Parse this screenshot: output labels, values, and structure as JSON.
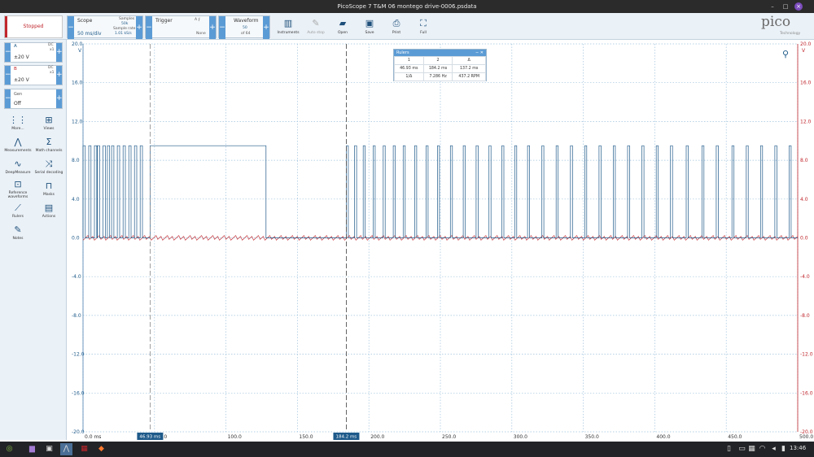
{
  "window": {
    "title": "PicoScope 7 T&M 06 montego drive-0006.psdata"
  },
  "toolbar": {
    "status": "Stopped",
    "scope": {
      "label": "Scope",
      "timebase": "50 ms/div",
      "samples_label": "Samples",
      "samples_value": "50k",
      "rate_label": "Sample rate",
      "rate_value": "1.01 kS/s"
    },
    "trigger": {
      "label": "Trigger",
      "mode": "None",
      "edge": "A ⨍"
    },
    "waveform": {
      "label": "Waveform",
      "current": "50",
      "of": "of 64"
    },
    "instruments_label": "Instruments",
    "autostop_label": "Auto stop",
    "open_label": "Open",
    "save_label": "Save",
    "print_label": "Print",
    "full_label": "Full",
    "brand": "pico",
    "brand_sub": "Technology"
  },
  "channels": [
    {
      "name": "A",
      "coupling": "DC",
      "probe": "x1",
      "range": "±20 V",
      "color": "#1e5a8a"
    },
    {
      "name": "B",
      "coupling": "DC",
      "probe": "x1",
      "range": "±20 V",
      "color": "#c0262d"
    }
  ],
  "generator": {
    "label": "Gen",
    "state": "Off"
  },
  "side_tools": [
    {
      "label": "More...",
      "icon": "dots-grid-icon"
    },
    {
      "label": "Views",
      "icon": "grid-icon"
    },
    {
      "label": "Measurements",
      "icon": "measure-icon"
    },
    {
      "label": "Math channels",
      "icon": "sigma-icon"
    },
    {
      "label": "DeepMeasure",
      "icon": "deepmeasure-icon"
    },
    {
      "label": "Serial decoding",
      "icon": "serial-icon"
    },
    {
      "label": "Reference waveforms",
      "icon": "reference-icon"
    },
    {
      "label": "Masks",
      "icon": "mask-icon"
    },
    {
      "label": "Rulers",
      "icon": "ruler-icon"
    },
    {
      "label": "Actions",
      "icon": "actions-icon"
    },
    {
      "label": "Notes",
      "icon": "notes-icon"
    }
  ],
  "rulers_panel": {
    "title": "Rulers",
    "headers": [
      "1",
      "2",
      "Δ"
    ],
    "row1": [
      "46.93 ms",
      "184.2 ms",
      "137.2 ms"
    ],
    "row2": [
      "1/Δ",
      "7.286 Hz",
      "437.2 RPM"
    ]
  },
  "cursors": {
    "left": "46.93 ms",
    "right": "184.2 ms"
  },
  "chart_data": {
    "type": "line",
    "x_unit": "ms",
    "xlim": [
      0,
      500
    ],
    "x_ticks": [
      "0.0 ms",
      "50.0",
      "100.0",
      "150.0",
      "200.0",
      "250.0",
      "300.0",
      "350.0",
      "400.0",
      "450.0",
      "500.0"
    ],
    "y_axes": [
      {
        "name": "A",
        "unit": "V",
        "lim": [
          -20,
          20
        ],
        "ticks": [
          "20.0",
          "16.0",
          "12.0",
          "8.0",
          "4.0",
          "0.0",
          "-4.0",
          "-8.0",
          "-12.0",
          "-16.0",
          "-20.0"
        ],
        "color": "#1e5a8a"
      },
      {
        "name": "B",
        "unit": "V",
        "lim": [
          -20,
          20
        ],
        "ticks": [
          "20.0",
          "16.0",
          "12.0",
          "8.0",
          "4.0",
          "0.0",
          "-4.0",
          "-8.0",
          "-12.0",
          "-16.0",
          "-20.0"
        ],
        "color": "#c0262d"
      }
    ],
    "grid": true,
    "series": [
      {
        "name": "A",
        "color": "#1e5a8a",
        "pulses_early_ms": [
          0,
          4,
          8,
          10,
          14,
          17,
          20,
          24,
          28,
          32,
          36,
          40
        ],
        "high_block_ms": [
          46.93,
          128
        ],
        "pulses_late_ms": [
          184.2,
          190,
          196,
          203,
          210,
          217,
          224,
          232,
          240,
          248,
          257,
          266,
          275,
          284,
          293,
          302,
          311,
          321,
          331,
          341,
          351,
          361,
          371,
          381,
          391,
          401,
          411,
          422,
          433,
          443,
          454,
          464,
          474,
          484,
          494
        ],
        "high_level_V": 9.5,
        "low_level_V": 0.0
      },
      {
        "name": "B",
        "color": "#c0262d",
        "level_V": 0.0
      }
    ]
  },
  "taskbar": {
    "time": "13:46"
  }
}
